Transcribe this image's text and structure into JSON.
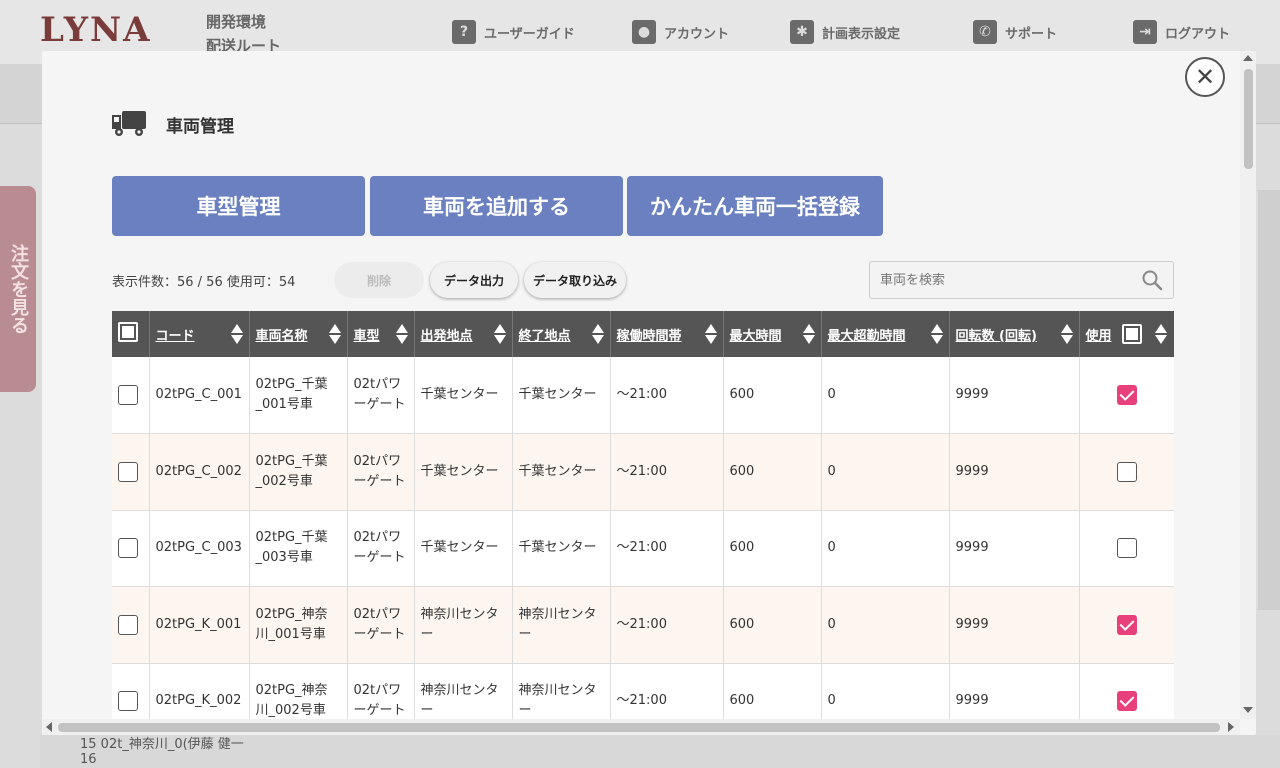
{
  "background": {
    "logo": "LYNA",
    "env_line1": "開発環境",
    "env_line2": "配送ルート",
    "nav": [
      {
        "label": "ユーザーガイド",
        "icon": "question-icon"
      },
      {
        "label": "アカウント",
        "icon": "account-icon"
      },
      {
        "label": "計画表示設定",
        "icon": "gear-icon"
      },
      {
        "label": "サポート",
        "icon": "support-icon"
      },
      {
        "label": "ログアウト",
        "icon": "logout-icon"
      }
    ],
    "side_tab": "注文を見る",
    "bottom_row1": "15  02t_神奈川_0(伊藤 健一",
    "bottom_row2": "16"
  },
  "modal": {
    "title": "車両管理",
    "buttons": {
      "vehicle_type": "車型管理",
      "add_vehicle": "車両を追加する",
      "bulk_register": "かんたん車両一括登録"
    },
    "count_text": "表示件数：56 / 56 使用可：54",
    "actions": {
      "delete": "削除",
      "export": "データ出力",
      "import": "データ取り込み"
    },
    "search": {
      "placeholder": "車両を検索",
      "value": ""
    },
    "table": {
      "headers": [
        "コード",
        "車両名称",
        "車型",
        "出発地点",
        "終了地点",
        "稼働時間帯",
        "最大時間",
        "最大超勤時間",
        "回転数 (回転)",
        "使用"
      ],
      "rows": [
        {
          "code": "02tPG_C_001",
          "name": "02tPG_千葉_001号車",
          "type": "02tパワーゲート",
          "start": "千葉センター",
          "end": "千葉センター",
          "hours": "～21:00",
          "max_time": "600",
          "max_overtime": "0",
          "rotations": "9999",
          "use": true
        },
        {
          "code": "02tPG_C_002",
          "name": "02tPG_千葉_002号車",
          "type": "02tパワーゲート",
          "start": "千葉センター",
          "end": "千葉センター",
          "hours": "～21:00",
          "max_time": "600",
          "max_overtime": "0",
          "rotations": "9999",
          "use": false
        },
        {
          "code": "02tPG_C_003",
          "name": "02tPG_千葉_003号車",
          "type": "02tパワーゲート",
          "start": "千葉センター",
          "end": "千葉センター",
          "hours": "～21:00",
          "max_time": "600",
          "max_overtime": "0",
          "rotations": "9999",
          "use": false
        },
        {
          "code": "02tPG_K_001",
          "name": "02tPG_神奈川_001号車",
          "type": "02tパワーゲート",
          "start": "神奈川センター",
          "end": "神奈川センター",
          "hours": "～21:00",
          "max_time": "600",
          "max_overtime": "0",
          "rotations": "9999",
          "use": true
        },
        {
          "code": "02tPG_K_002",
          "name": "02tPG_神奈川_002号車",
          "type": "02tパワーゲート",
          "start": "神奈川センター",
          "end": "神奈川センター",
          "hours": "～21:00",
          "max_time": "600",
          "max_overtime": "0",
          "rotations": "9999",
          "use": true
        }
      ]
    }
  },
  "colors": {
    "accent_button": "#6a80c0",
    "header_dark": "#555555",
    "check_on": "#e8407a"
  }
}
